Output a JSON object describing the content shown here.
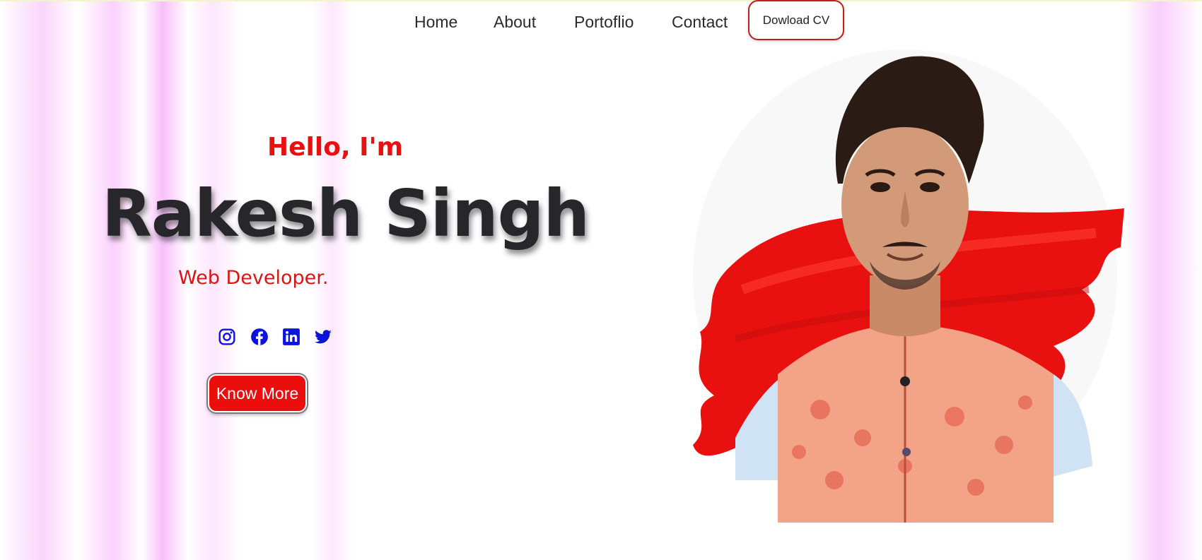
{
  "nav": {
    "items": [
      {
        "label": "Home"
      },
      {
        "label": "About"
      },
      {
        "label": "Portoflio"
      },
      {
        "label": "Contact"
      }
    ],
    "cv_button": "Dowload CV"
  },
  "hero": {
    "greeting": "Hello, I'm",
    "name": "Rakesh Singh",
    "role": "Web Developer.",
    "cta": "Know More",
    "social_icons": [
      "instagram-icon",
      "facebook-icon",
      "linkedin-icon",
      "twitter-icon"
    ]
  },
  "colors": {
    "accent": "#e8110f",
    "icon_blue": "#0b14d9",
    "heading_dark": "#26262b",
    "streak_pink": "#f6b4fa"
  }
}
